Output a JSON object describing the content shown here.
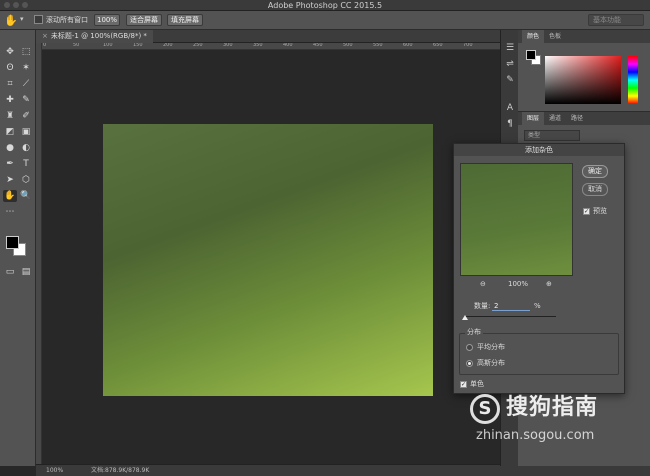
{
  "app": {
    "title": "Adobe Photoshop CC 2015.5"
  },
  "options_bar": {
    "scroll_all_label": "滚动所有窗口",
    "zoom_100_label": "100%",
    "fit_screen_label": "适合屏幕",
    "fill_screen_label": "填充屏幕",
    "workspace_label": "基本功能"
  },
  "document_tab": {
    "title": "未标题-1 @ 100%(RGB/8*) *"
  },
  "ruler": {
    "ticks": [
      "0",
      "50",
      "100",
      "150",
      "200",
      "250",
      "300",
      "350",
      "400",
      "450",
      "500",
      "550",
      "600",
      "650",
      "700"
    ]
  },
  "status": {
    "zoom": "100%",
    "doc_info": "文档:878.9K/878.9K"
  },
  "color_panel": {
    "tabs": [
      "颜色",
      "色板"
    ]
  },
  "layers_panel": {
    "tabs": [
      "图层",
      "通道",
      "路径"
    ],
    "filter_label": "类型"
  },
  "dialog": {
    "title": "添加杂色",
    "ok_label": "确定",
    "cancel_label": "取消",
    "preview_label": "预览",
    "preview_checked": true,
    "zoom_level": "100%",
    "amount_label": "数量:",
    "amount_value": "2",
    "amount_unit": "%",
    "distribution_label": "分布",
    "uniform_label": "平均分布",
    "gaussian_label": "高斯分布",
    "selected_distribution": "gaussian",
    "monochromatic_label": "单色",
    "monochromatic_checked": true
  },
  "watermark": {
    "brand": "搜狗指南",
    "url": "zhinan.sogou.com"
  }
}
